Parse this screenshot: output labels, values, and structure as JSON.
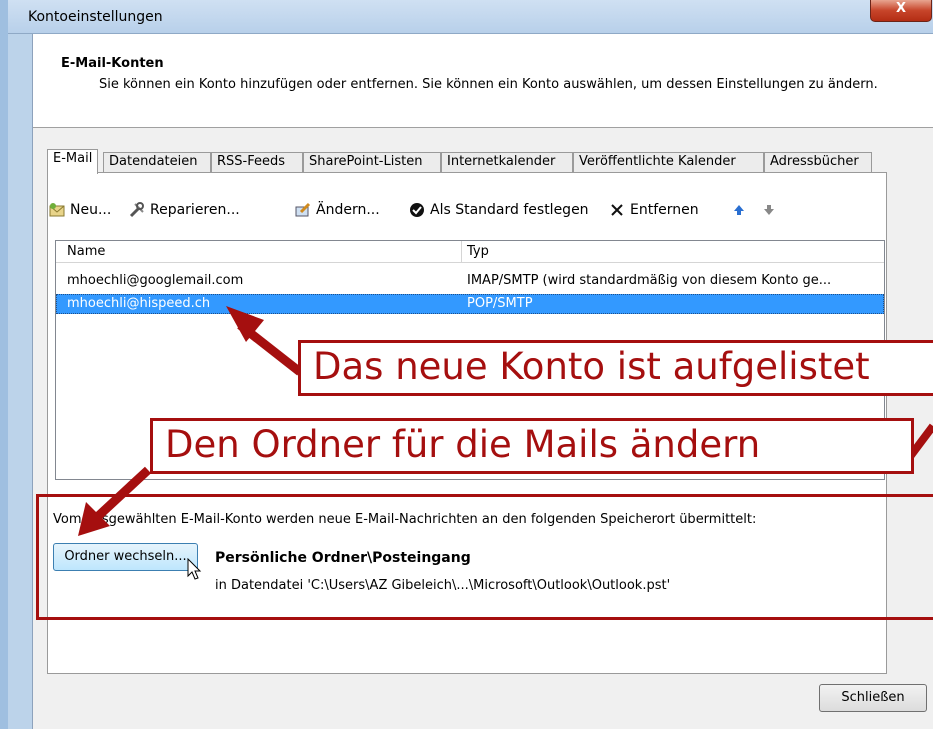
{
  "window": {
    "title": "Kontoeinstellungen",
    "close_label": "X"
  },
  "header": {
    "title": "E-Mail-Konten",
    "description": "Sie können ein Konto hinzufügen oder entfernen. Sie können ein Konto auswählen, um dessen Einstellungen zu ändern."
  },
  "tabs": [
    "E-Mail",
    "Datendateien",
    "RSS-Feeds",
    "SharePoint-Listen",
    "Internetkalender",
    "Veröffentlichte Kalender",
    "Adressbücher"
  ],
  "toolbar": {
    "new_label": "Neu...",
    "repair_label": "Reparieren...",
    "change_label": "Ändern...",
    "default_label": "Als Standard festlegen",
    "remove_label": "Entfernen"
  },
  "list": {
    "columns": [
      "Name",
      "Typ"
    ],
    "rows": [
      {
        "name": "mhoechli@googlemail.com",
        "type": "IMAP/SMTP (wird standardmäßig von diesem Konto ge..."
      },
      {
        "name": "mhoechli@hispeed.ch",
        "type": "POP/SMTP"
      }
    ]
  },
  "delivery": {
    "description": "Vom ausgewählten E-Mail-Konto werden neue E-Mail-Nachrichten an den folgenden Speicherort übermittelt:",
    "change_folder_label": "Ordner wechseln...",
    "folder_name": "Persönliche Ordner\\Posteingang",
    "folder_path": "in Datendatei 'C:\\Users\\AZ Gibeleich\\...\\Microsoft\\Outlook\\Outlook.pst'"
  },
  "close_button_label": "Schließen",
  "annotations": {
    "callout_1": "Das neue Konto ist aufgelistet",
    "callout_2": "Den Ordner für die Mails ändern",
    "color": "#a50f0f"
  },
  "colors": {
    "selection": "#3399ff",
    "title_bar": "#bcd3ea",
    "close_button": "#c7452a"
  }
}
